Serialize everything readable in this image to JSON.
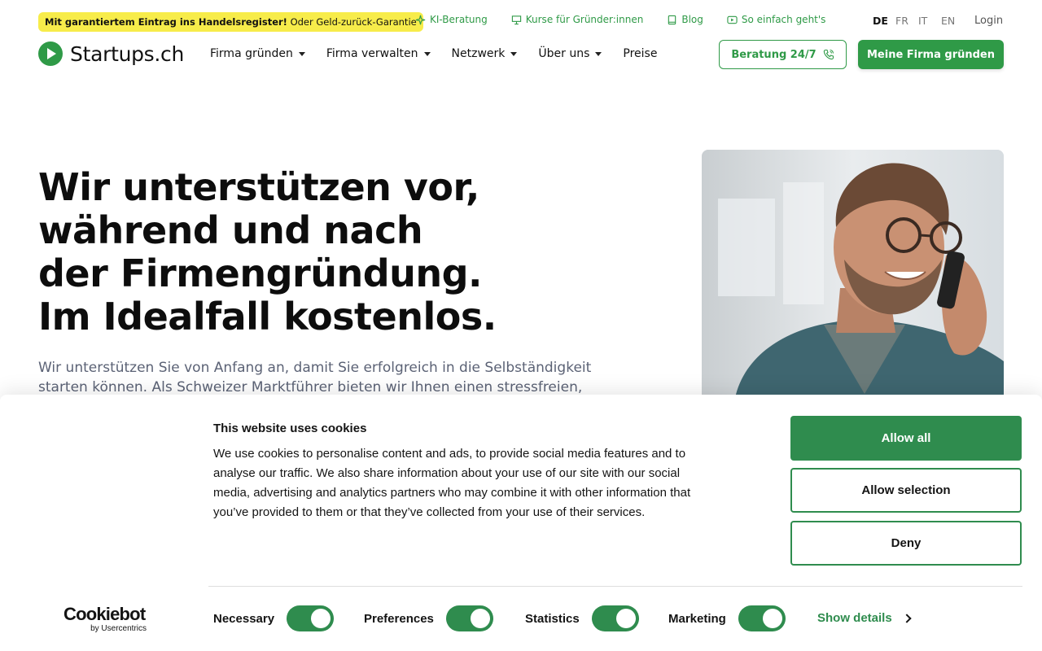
{
  "colors": {
    "brand_green": "#2f9a47",
    "cookie_green": "#2f8c4e",
    "promo_yellow": "#f7ec4a"
  },
  "topbar": {
    "promo_bold": "Mit garantiertem Eintrag ins Handelsregister!",
    "promo_rest": " Oder Geld-zurück-Garantie",
    "links": [
      {
        "label": "KI-Beratung",
        "icon": "sparkle-icon"
      },
      {
        "label": "Kurse für Gründer:innen",
        "icon": "presentation-icon"
      },
      {
        "label": "Blog",
        "icon": "book-icon"
      },
      {
        "label": "So einfach geht's",
        "icon": "play-icon"
      }
    ],
    "languages": [
      "DE",
      "FR",
      "IT",
      "EN"
    ],
    "active_language": "DE",
    "login": "Login"
  },
  "header": {
    "logo_text": "Startups.ch",
    "nav": [
      {
        "label": "Firma gründen",
        "dropdown": true
      },
      {
        "label": "Firma verwalten",
        "dropdown": true
      },
      {
        "label": "Netzwerk",
        "dropdown": true
      },
      {
        "label": "Über uns",
        "dropdown": true
      },
      {
        "label": "Preise",
        "dropdown": false
      }
    ],
    "consult_button": "Beratung 24/7",
    "cta_button": "Meine Firma gründen"
  },
  "hero": {
    "title_lines": [
      "Wir unterstützen vor,",
      "während und nach",
      "der Firmengründung.",
      "Im Idealfall kostenlos."
    ],
    "text_lines": [
      "Wir unterstützen Sie von Anfang an, damit Sie erfolgreich in die Selbständigkeit",
      "starten können. Als Schweizer Marktführer bieten wir Ihnen einen stressfreien,"
    ]
  },
  "cookie_banner": {
    "title": "This website uses cookies",
    "body_lines": [
      "We use cookies to personalise content and ads, to provide social media features and to",
      "analyse our traffic. We also share information about your use of our site with our social",
      "media, advertising and analytics partners who may combine it with other information that",
      "you’ve provided to them or that they’ve collected from your use of their services."
    ],
    "allow_all": "Allow all",
    "allow_selection": "Allow selection",
    "deny": "Deny",
    "logo_main": "Cookiebot",
    "logo_sub": "by Usercentrics",
    "options": [
      {
        "label": "Necessary",
        "enabled": true
      },
      {
        "label": "Preferences",
        "enabled": true
      },
      {
        "label": "Statistics",
        "enabled": true
      },
      {
        "label": "Marketing",
        "enabled": true
      }
    ],
    "show_details": "Show details"
  }
}
